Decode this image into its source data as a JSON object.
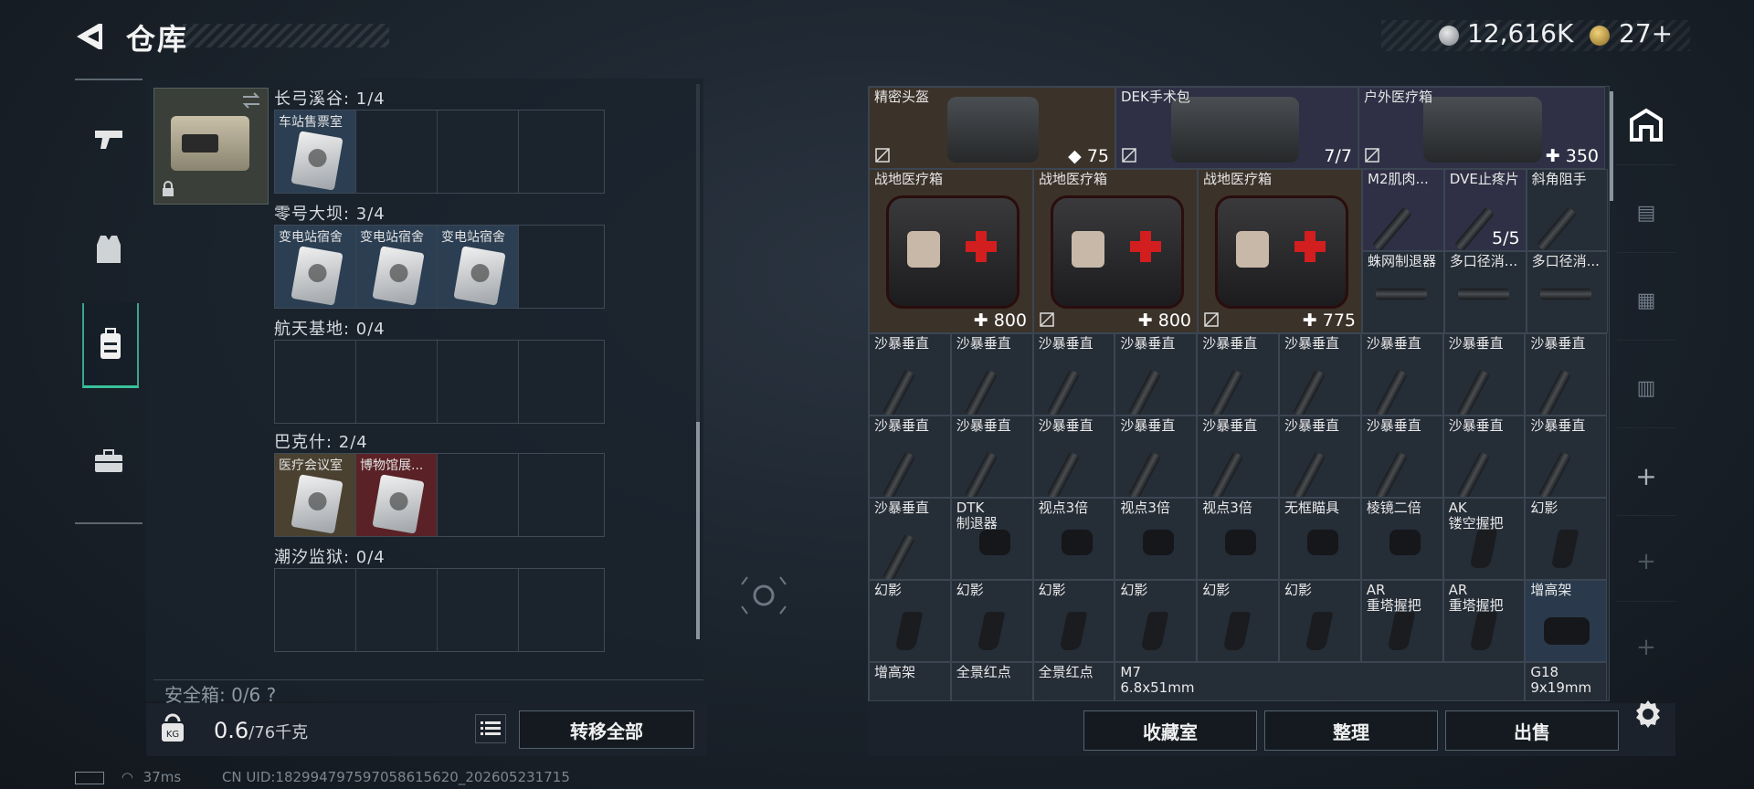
{
  "header": {
    "title": "仓库"
  },
  "currency": {
    "silver": "12,616K",
    "gold": "27+"
  },
  "left_nav": {
    "items": [
      "weapon",
      "armor",
      "backpack",
      "briefcase"
    ]
  },
  "left_panel": {
    "sections": [
      {
        "label": "长弓溪谷: 1/4",
        "slots": [
          {
            "text": "车站售票室",
            "color": "blue"
          },
          {
            "text": "",
            "color": ""
          },
          {
            "text": "",
            "color": ""
          },
          {
            "text": "",
            "color": ""
          }
        ]
      },
      {
        "label": "零号大坝: 3/4",
        "slots": [
          {
            "text": "变电站宿舍",
            "color": "blue"
          },
          {
            "text": "变电站宿舍",
            "color": "blue"
          },
          {
            "text": "变电站宿舍",
            "color": "blue"
          },
          {
            "text": "",
            "color": ""
          }
        ]
      },
      {
        "label": "航天基地: 0/4",
        "slots": [
          {
            "text": "",
            "color": ""
          },
          {
            "text": "",
            "color": ""
          },
          {
            "text": "",
            "color": ""
          },
          {
            "text": "",
            "color": ""
          }
        ]
      },
      {
        "label": "巴克什: 2/4",
        "slots": [
          {
            "text": "医疗会议室",
            "color": "gold"
          },
          {
            "text": "博物馆展...",
            "color": "red"
          },
          {
            "text": "",
            "color": ""
          },
          {
            "text": "",
            "color": ""
          }
        ]
      },
      {
        "label": "潮汐监狱: 0/4",
        "slots": [
          {
            "text": "",
            "color": ""
          },
          {
            "text": "",
            "color": ""
          },
          {
            "text": "",
            "color": ""
          },
          {
            "text": "",
            "color": ""
          }
        ]
      }
    ],
    "safebox_label": "安全箱: 0/6 ?"
  },
  "bottom_left": {
    "weight_current": "0.6",
    "weight_max": "/76千克",
    "transfer_label": "转移全部"
  },
  "status": {
    "ping": "37ms",
    "uid": "CN UID:182994797597058615620_202605231715"
  },
  "grid": {
    "top_items": [
      {
        "name": "精密头盔",
        "value": "75",
        "value_icon": "shield",
        "color": "brown"
      },
      {
        "name": "DEK手术包",
        "value": "7/7",
        "value_icon": "",
        "color": "purple"
      },
      {
        "name": "户外医疗箱",
        "value": "350",
        "value_icon": "plus",
        "color": "purple"
      }
    ],
    "medkits": [
      {
        "name": "战地医疗箱",
        "value": "800"
      },
      {
        "name": "战地医疗箱",
        "value": "800"
      },
      {
        "name": "战地医疗箱",
        "value": "775"
      }
    ],
    "small_row1": [
      {
        "name": "M2肌肉...",
        "value": "",
        "color": "purple"
      },
      {
        "name": "DVE止疼片",
        "value": "5/5",
        "color": "purple"
      },
      {
        "name": "斜角阻手",
        "value": "",
        "color": ""
      }
    ],
    "small_row2": [
      {
        "name": "蛛网制退器",
        "color": ""
      },
      {
        "name": "多口径消...",
        "color": ""
      },
      {
        "name": "多口径消...",
        "color": ""
      }
    ],
    "rows": [
      [
        "沙暴垂直",
        "沙暴垂直",
        "沙暴垂直",
        "沙暴垂直",
        "沙暴垂直",
        "沙暴垂直",
        "沙暴垂直",
        "沙暴垂直",
        "沙暴垂直"
      ],
      [
        "沙暴垂直",
        "沙暴垂直",
        "沙暴垂直",
        "沙暴垂直",
        "沙暴垂直",
        "沙暴垂直",
        "沙暴垂直",
        "沙暴垂直",
        "沙暴垂直"
      ],
      [
        "沙暴垂直",
        "DTK\n制退器",
        "视点3倍",
        "视点3倍",
        "视点3倍",
        "无框瞄具",
        "棱镜二倍",
        "AK\n镂空握把",
        "幻影"
      ],
      [
        "幻影",
        "幻影",
        "幻影",
        "幻影",
        "幻影",
        "幻影",
        "AR\n重塔握把",
        "AR\n重塔握把",
        "增高架"
      ]
    ],
    "bottom_row": [
      {
        "name": "增高架",
        "span": 1
      },
      {
        "name": "全景红点",
        "span": 1
      },
      {
        "name": "全景红点",
        "span": 1
      },
      {
        "name": "M7\n6.8x51mm",
        "span": 5
      },
      {
        "name": "G18\n9x19mm",
        "span": 1
      }
    ]
  },
  "bottom_right": {
    "collection_label": "收藏室",
    "organize_label": "整理",
    "sell_label": "出售"
  }
}
